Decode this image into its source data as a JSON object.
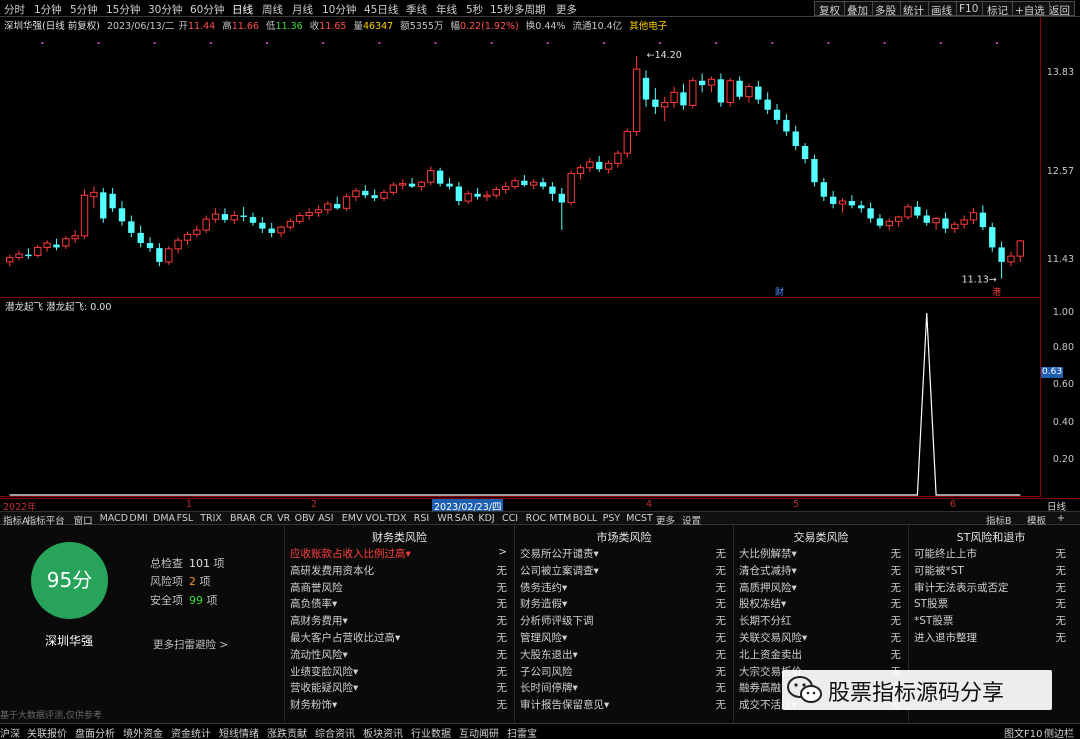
{
  "periods": [
    "分时",
    "1分钟",
    "5分钟",
    "15分钟",
    "30分钟",
    "60分钟",
    "日线",
    "周线",
    "月线",
    "10分钟",
    "45日线",
    "季线",
    "年线",
    "5秒",
    "15秒",
    "多周期",
    "更多"
  ],
  "active_period": "日线",
  "right_buttons": [
    "复权",
    "叠加",
    "多股",
    "统计",
    "画线",
    "F10",
    "标记",
    "+自选",
    "返回"
  ],
  "quote": {
    "name": "深圳华强(日线 前复权)",
    "date": "2023/06/13/二",
    "open_label": "开",
    "open": "11.44",
    "high_label": "高",
    "high": "11.66",
    "low_label": "低",
    "low": "11.36",
    "close_label": "收",
    "close": "11.65",
    "vol_label": "量",
    "vol": "46347",
    "amt_label": "额",
    "amt": "5355万",
    "chg_label": "幅",
    "chg": "0.22(1.92%)",
    "turn_label": "换",
    "turn": "0.44%",
    "float_label": "流通",
    "float": "10.4亿",
    "sector": "其他电子"
  },
  "price_axis": [
    "13.83",
    "12.57",
    "11.43"
  ],
  "price_marks": {
    "high": "14.20",
    "low": "11.13",
    "caiwu": "财",
    "gang": "港"
  },
  "indicator_title": "潜龙起飞 潜龙起飞: 0.00",
  "ind_axis": [
    "1.00",
    "0.80",
    "0.63",
    "0.60",
    "0.40",
    "0.20"
  ],
  "ind_cursor_value": "0.63",
  "date_axis": {
    "year": "2022年",
    "m1": "1",
    "m2": "2",
    "cursor": "2023/02/23/四",
    "m4": "4",
    "m5": "5",
    "m6": "6",
    "right": "日线"
  },
  "indicator_tabs": [
    "指标A",
    "指标平台",
    "窗口",
    "MACD",
    "DMI",
    "DMA",
    "FSL",
    "TRIX",
    "BRAR",
    "CR",
    "VR",
    "OBV",
    "ASI",
    "EMV",
    "VOL-TDX",
    "RSI",
    "WR",
    "SAR",
    "KDJ",
    "CCI",
    "ROC",
    "MTM",
    "BOLL",
    "PSY",
    "MCST",
    "更多",
    "设置"
  ],
  "indicator_tabs_right": [
    "指标B",
    "模板",
    "+"
  ],
  "risk": {
    "score": "95分",
    "stock": "深圳华强",
    "total_label": "总检查",
    "total": "101",
    "unit": "项",
    "risk_label": "风险项",
    "risk_count": "2",
    "safe_label": "安全项",
    "safe": "99",
    "more": "更多扫雷避险 >",
    "note": "基于大数据评测,仅供参考",
    "columns": [
      {
        "title": "财务类风险",
        "rows": [
          {
            "label": "应收账款占收入比例过高▾",
            "value": ">",
            "warn": true
          },
          {
            "label": "高研发费用资本化",
            "value": "无"
          },
          {
            "label": "高商誉风险",
            "value": "无"
          },
          {
            "label": "高负债率▾",
            "value": "无"
          },
          {
            "label": "高财务费用▾",
            "value": "无"
          },
          {
            "label": "最大客户占营收比过高▾",
            "value": "无"
          },
          {
            "label": "流动性风险▾",
            "value": "无"
          },
          {
            "label": "业绩变脸风险▾",
            "value": "无"
          },
          {
            "label": "营收能疑风险▾",
            "value": "无"
          },
          {
            "label": "财务粉饰▾",
            "value": "无"
          }
        ]
      },
      {
        "title": "市场类风险",
        "rows": [
          {
            "label": "交易所公开谴责▾",
            "value": "无"
          },
          {
            "label": "公司被立案调查▾",
            "value": "无"
          },
          {
            "label": "债务违约▾",
            "value": "无"
          },
          {
            "label": "财务造假▾",
            "value": "无"
          },
          {
            "label": "分析师评级下调",
            "value": "无"
          },
          {
            "label": "管理风险▾",
            "value": "无"
          },
          {
            "label": "大股东退出▾",
            "value": "无"
          },
          {
            "label": "子公司风险",
            "value": "无"
          },
          {
            "label": "长时间停牌▾",
            "value": "无"
          },
          {
            "label": "审计报告保留意见▾",
            "value": "无"
          }
        ]
      },
      {
        "title": "交易类风险",
        "rows": [
          {
            "label": "大比例解禁▾",
            "value": "无"
          },
          {
            "label": "清仓式减持▾",
            "value": "无"
          },
          {
            "label": "高质押风险▾",
            "value": "无"
          },
          {
            "label": "股权冻结▾",
            "value": "无"
          },
          {
            "label": "长期不分红",
            "value": "无"
          },
          {
            "label": "关联交易风险▾",
            "value": "无"
          },
          {
            "label": "北上资金卖出",
            "value": "无"
          },
          {
            "label": "大宗交易折价",
            "value": "无"
          },
          {
            "label": "融券高融",
            "value": "无"
          },
          {
            "label": "成交不活跃▾",
            "value": "无"
          }
        ]
      },
      {
        "title": "ST风险和退市",
        "rows": [
          {
            "label": "可能终止上市",
            "value": "无"
          },
          {
            "label": "可能被*ST",
            "value": "无"
          },
          {
            "label": "审计无法表示或否定",
            "value": "无"
          },
          {
            "label": "ST股票",
            "value": "无"
          },
          {
            "label": "*ST股票",
            "value": "无"
          },
          {
            "label": "进入退市整理",
            "value": "无"
          }
        ]
      }
    ]
  },
  "watermark": "股票指标源码分享",
  "bottom_tabs": [
    "沪深",
    "关联报价",
    "盘面分析",
    "境外资金",
    "资金统计",
    "短线情绪",
    "涨跌贡献",
    "综合资讯",
    "板块资讯",
    "行业数据",
    "互动闻研",
    "扫雷宝"
  ],
  "bottom_right": [
    "图文F10",
    "侧边栏"
  ],
  "colors": {
    "up": "#ff3b3b",
    "down": "#54ffff",
    "grid": "#8b0000",
    "score": "#27a35a",
    "warn": "#ff4040"
  },
  "candles": [
    [
      11.36,
      11.46,
      11.3,
      11.42
    ],
    [
      11.42,
      11.52,
      11.38,
      11.47
    ],
    [
      11.46,
      11.55,
      11.4,
      11.44
    ],
    [
      11.45,
      11.6,
      11.42,
      11.56
    ],
    [
      11.56,
      11.66,
      11.5,
      11.62
    ],
    [
      11.6,
      11.68,
      11.52,
      11.56
    ],
    [
      11.58,
      11.72,
      11.54,
      11.68
    ],
    [
      11.68,
      11.8,
      11.62,
      11.72
    ],
    [
      11.72,
      12.36,
      11.68,
      12.28
    ],
    [
      12.26,
      12.4,
      12.1,
      12.32
    ],
    [
      12.32,
      12.38,
      11.9,
      11.96
    ],
    [
      12.3,
      12.38,
      12.05,
      12.1
    ],
    [
      12.1,
      12.2,
      11.86,
      11.92
    ],
    [
      11.92,
      12.0,
      11.7,
      11.76
    ],
    [
      11.76,
      11.86,
      11.56,
      11.62
    ],
    [
      11.62,
      11.7,
      11.5,
      11.55
    ],
    [
      11.55,
      11.62,
      11.3,
      11.36
    ],
    [
      11.36,
      11.58,
      11.32,
      11.54
    ],
    [
      11.54,
      11.7,
      11.48,
      11.66
    ],
    [
      11.66,
      11.78,
      11.6,
      11.74
    ],
    [
      11.74,
      11.86,
      11.7,
      11.8
    ],
    [
      11.8,
      12.0,
      11.76,
      11.95
    ],
    [
      11.95,
      12.1,
      11.9,
      12.02
    ],
    [
      12.02,
      12.1,
      11.9,
      11.94
    ],
    [
      11.94,
      12.06,
      11.88,
      12.0
    ],
    [
      12.0,
      12.12,
      11.92,
      11.98
    ],
    [
      11.98,
      12.04,
      11.86,
      11.9
    ],
    [
      11.9,
      11.98,
      11.76,
      11.82
    ],
    [
      11.82,
      11.9,
      11.7,
      11.76
    ],
    [
      11.76,
      11.86,
      11.7,
      11.84
    ],
    [
      11.84,
      11.96,
      11.8,
      11.92
    ],
    [
      11.92,
      12.04,
      11.88,
      12.0
    ],
    [
      12.0,
      12.1,
      11.94,
      12.04
    ],
    [
      12.04,
      12.14,
      11.98,
      12.08
    ],
    [
      12.08,
      12.2,
      12.02,
      12.16
    ],
    [
      12.16,
      12.26,
      12.08,
      12.1
    ],
    [
      12.1,
      12.3,
      12.06,
      12.26
    ],
    [
      12.26,
      12.38,
      12.2,
      12.34
    ],
    [
      12.34,
      12.42,
      12.24,
      12.28
    ],
    [
      12.28,
      12.36,
      12.2,
      12.24
    ],
    [
      12.24,
      12.36,
      12.2,
      12.32
    ],
    [
      12.32,
      12.46,
      12.28,
      12.42
    ],
    [
      12.42,
      12.5,
      12.36,
      12.44
    ],
    [
      12.44,
      12.52,
      12.38,
      12.4
    ],
    [
      12.4,
      12.48,
      12.34,
      12.46
    ],
    [
      12.46,
      12.68,
      12.42,
      12.62
    ],
    [
      12.62,
      12.66,
      12.4,
      12.44
    ],
    [
      12.44,
      12.52,
      12.36,
      12.4
    ],
    [
      12.4,
      12.46,
      12.14,
      12.2
    ],
    [
      12.2,
      12.34,
      12.16,
      12.3
    ],
    [
      12.3,
      12.38,
      12.22,
      12.26
    ],
    [
      12.26,
      12.34,
      12.2,
      12.28
    ],
    [
      12.28,
      12.4,
      12.24,
      12.36
    ],
    [
      12.36,
      12.46,
      12.3,
      12.4
    ],
    [
      12.4,
      12.52,
      12.36,
      12.48
    ],
    [
      12.48,
      12.56,
      12.4,
      12.42
    ],
    [
      12.42,
      12.5,
      12.36,
      12.46
    ],
    [
      12.46,
      12.52,
      12.36,
      12.4
    ],
    [
      12.4,
      12.46,
      12.2,
      12.3
    ],
    [
      12.3,
      12.38,
      11.8,
      12.18
    ],
    [
      12.18,
      12.62,
      12.14,
      12.58
    ],
    [
      12.58,
      12.7,
      12.5,
      12.66
    ],
    [
      12.66,
      12.8,
      12.6,
      12.74
    ],
    [
      12.74,
      12.82,
      12.6,
      12.64
    ],
    [
      12.64,
      12.76,
      12.58,
      12.72
    ],
    [
      12.72,
      12.9,
      12.66,
      12.86
    ],
    [
      12.86,
      13.2,
      12.8,
      13.16
    ],
    [
      13.16,
      14.2,
      13.1,
      14.02
    ],
    [
      13.9,
      14.0,
      13.5,
      13.6
    ],
    [
      13.6,
      13.76,
      13.4,
      13.5
    ],
    [
      13.5,
      13.64,
      13.3,
      13.56
    ],
    [
      13.56,
      13.78,
      13.48,
      13.7
    ],
    [
      13.7,
      13.82,
      13.46,
      13.52
    ],
    [
      13.52,
      13.9,
      13.48,
      13.86
    ],
    [
      13.86,
      13.96,
      13.7,
      13.8
    ],
    [
      13.8,
      13.92,
      13.7,
      13.88
    ],
    [
      13.88,
      13.96,
      13.5,
      13.56
    ],
    [
      13.56,
      13.9,
      13.5,
      13.86
    ],
    [
      13.86,
      13.92,
      13.6,
      13.64
    ],
    [
      13.64,
      13.82,
      13.56,
      13.78
    ],
    [
      13.78,
      13.86,
      13.54,
      13.6
    ],
    [
      13.6,
      13.7,
      13.4,
      13.46
    ],
    [
      13.46,
      13.54,
      13.26,
      13.32
    ],
    [
      13.32,
      13.4,
      13.1,
      13.16
    ],
    [
      13.16,
      13.24,
      12.9,
      12.96
    ],
    [
      12.96,
      13.0,
      12.72,
      12.78
    ],
    [
      12.78,
      12.84,
      12.4,
      12.46
    ],
    [
      12.46,
      12.52,
      12.2,
      12.26
    ],
    [
      12.26,
      12.34,
      12.1,
      12.16
    ],
    [
      12.16,
      12.24,
      12.04,
      12.2
    ],
    [
      12.2,
      12.28,
      12.1,
      12.14
    ],
    [
      12.14,
      12.2,
      12.04,
      12.1
    ],
    [
      12.1,
      12.18,
      11.9,
      11.96
    ],
    [
      11.96,
      12.02,
      11.82,
      11.86
    ],
    [
      11.86,
      11.96,
      11.8,
      11.92
    ],
    [
      11.92,
      12.0,
      11.84,
      11.98
    ],
    [
      11.98,
      12.16,
      11.94,
      12.12
    ],
    [
      12.12,
      12.2,
      11.96,
      12.0
    ],
    [
      12.0,
      12.08,
      11.86,
      11.9
    ],
    [
      11.9,
      11.98,
      11.8,
      11.96
    ],
    [
      11.96,
      12.04,
      11.76,
      11.82
    ],
    [
      11.82,
      11.92,
      11.76,
      11.88
    ],
    [
      11.88,
      12.0,
      11.82,
      11.94
    ],
    [
      11.94,
      12.1,
      11.88,
      12.04
    ],
    [
      12.04,
      12.14,
      11.8,
      11.84
    ],
    [
      11.84,
      11.9,
      11.5,
      11.56
    ],
    [
      11.56,
      11.64,
      11.13,
      11.36
    ],
    [
      11.36,
      11.5,
      11.3,
      11.44
    ],
    [
      11.44,
      11.66,
      11.36,
      11.65
    ]
  ],
  "indicator": {
    "peak_index": 98,
    "peak_value": 1.0
  }
}
